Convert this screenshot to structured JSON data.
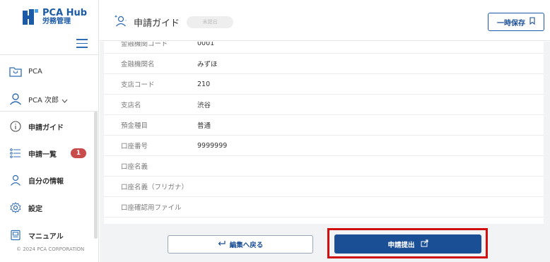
{
  "app": {
    "logo_title": "PCA Hub",
    "logo_sub": "労務管理",
    "copyright": "© 2024 PCA CORPORATION"
  },
  "sidebar": {
    "company_label": "PCA",
    "user_label": "PCA 次郎",
    "items": [
      {
        "label": "申請ガイド",
        "icon": "info-icon"
      },
      {
        "label": "申請一覧",
        "icon": "list-icon",
        "badge": "1"
      },
      {
        "label": "自分の情報",
        "icon": "person-icon"
      },
      {
        "label": "設定",
        "icon": "gear-icon"
      },
      {
        "label": "マニュアル",
        "icon": "book-icon"
      }
    ]
  },
  "header": {
    "title": "申請ガイド",
    "status": "未提出",
    "save_label": "一時保存"
  },
  "form": {
    "rows": [
      {
        "label": "金融機関コード",
        "value": "0001"
      },
      {
        "label": "金融機関名",
        "value": "みずほ"
      },
      {
        "label": "支店コード",
        "value": "210"
      },
      {
        "label": "支店名",
        "value": "渋谷"
      },
      {
        "label": "預金種目",
        "value": "普通"
      },
      {
        "label": "口座番号",
        "value": "9999999"
      },
      {
        "label": "口座名義",
        "value": ""
      },
      {
        "label": "口座名義（フリガナ）",
        "value": ""
      },
      {
        "label": "口座確認用ファイル",
        "value": ""
      }
    ]
  },
  "footer": {
    "back_label": "編集へ戻る",
    "submit_label": "申請提出"
  },
  "colors": {
    "brand": "#1b5aa6",
    "primary_button": "#1a4f96",
    "highlight": "#d20f0f",
    "badge": "#c94c4c"
  }
}
